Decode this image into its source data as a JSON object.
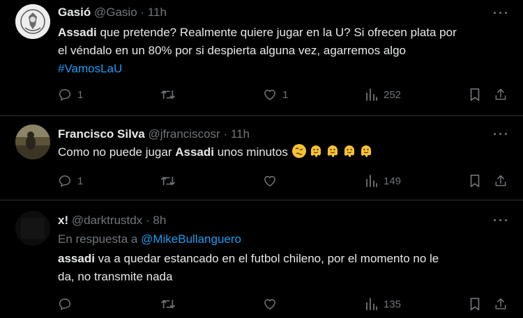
{
  "tweets": [
    {
      "name": "Gasió",
      "handle": "@Gasio",
      "sep": "·",
      "time": "11h",
      "text_bold": "Assadi",
      "text_line1_rest": " que pretende? Realmente quiere jugar en la U? Si ofrecen plata por",
      "text_line2": "el véndalo en un 80% por si despierta alguna vez, agarremos algo",
      "hashtag": "#VamosLaU",
      "replies": "1",
      "retweets": "",
      "likes": "1",
      "views": "252"
    },
    {
      "name": "Francisco Silva",
      "handle": "@jfranciscosr",
      "sep": "·",
      "time": "11h",
      "text_pre": "Como no puede jugar ",
      "text_bold": "Assadi",
      "text_post": " unos minutos ",
      "emojis": [
        "woozy-face",
        "melting-face",
        "melting-face",
        "melting-face",
        "melting-face"
      ],
      "replies": "1",
      "retweets": "",
      "likes": "",
      "views": "149"
    },
    {
      "name": "x!",
      "handle": "@darktrustdx",
      "sep": "·",
      "time": "8h",
      "reply_prefix": "En respuesta a ",
      "reply_handle": "@MikeBullanguero",
      "text_bold": "assadi",
      "text_line1_rest": " va a quedar estancado en el futbol chileno, por el momento no le",
      "text_line2": "da, no transmite nada",
      "replies": "",
      "retweets": "",
      "likes": "",
      "views": "135"
    }
  ],
  "colors": {
    "background": "#000000",
    "text": "#e7e9ea",
    "muted": "#71767b",
    "link": "#1d9bf0",
    "divider": "#2f3336"
  }
}
